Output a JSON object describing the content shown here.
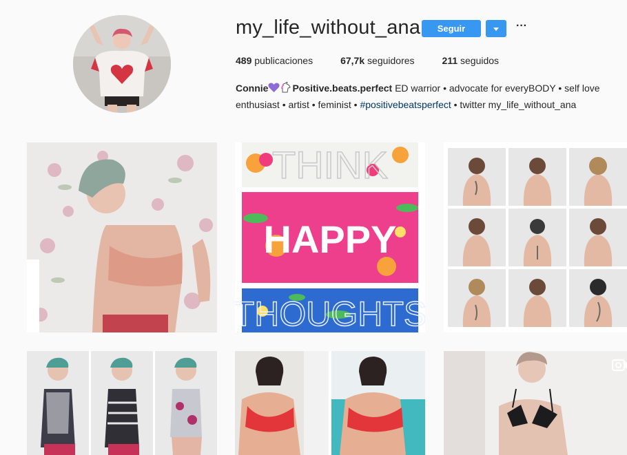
{
  "profile": {
    "username": "my_life_without_ana",
    "follow_label": "Seguir",
    "dropdown_icon": "chevron-down-icon",
    "more_icon": "ellipsis-icon",
    "more_label": "···"
  },
  "stats": {
    "posts_count": "489",
    "posts_label": "publicaciones",
    "followers_count": "67,7k",
    "followers_label": "seguidores",
    "following_count": "211",
    "following_label": "seguidos"
  },
  "bio": {
    "name": "Connie",
    "title": "Positive.beats.perfect",
    "line1_rest": "ED warrior • advocate for everyBODY • self love",
    "line2_start": "enthusiast • artist • feminist •",
    "hashtag": "#positivebeatsperfect",
    "line2_end": "• twitter my_life_without_ana"
  },
  "posts": [
    {
      "kind": "photo"
    },
    {
      "kind": "artwork",
      "words": [
        "THINK",
        "HAPPY",
        "THOUGHTS"
      ]
    },
    {
      "kind": "photo-grid"
    },
    {
      "kind": "photo"
    },
    {
      "kind": "photo"
    },
    {
      "kind": "video",
      "icon": "video-icon"
    }
  ],
  "colors": {
    "accent": "#3897f0",
    "hashtag": "#003569",
    "text": "#262626",
    "background": "#fafafa"
  }
}
